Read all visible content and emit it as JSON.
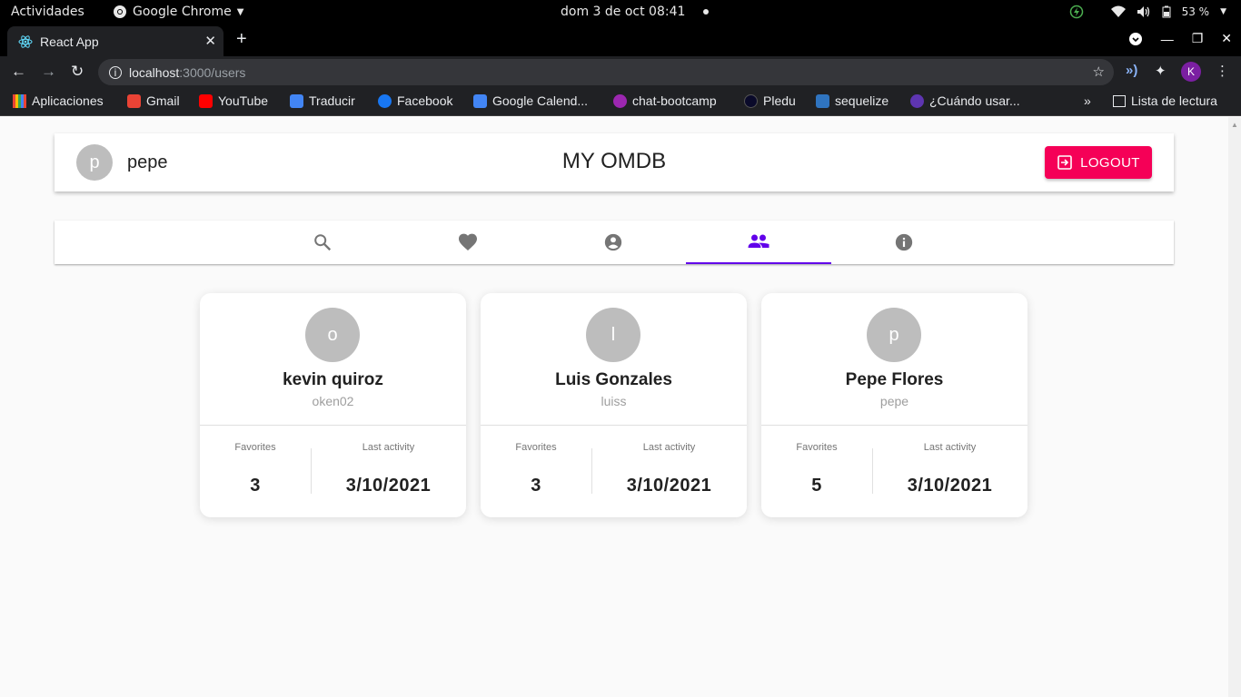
{
  "os": {
    "activities": "Actividades",
    "app_name": "Google Chrome",
    "date": "dom  3 de oct  08:41",
    "battery": "53 %"
  },
  "browser": {
    "tab_title": "React App",
    "url_host": "localhost",
    "url_path": ":3000/users",
    "profile_initial": "K",
    "bookmarks": [
      {
        "label": "Aplicaciones",
        "color": "#4285f4"
      },
      {
        "label": "Gmail",
        "color": "#ea4335"
      },
      {
        "label": "YouTube",
        "color": "#ff0000"
      },
      {
        "label": "Traducir",
        "color": "#4285f4"
      },
      {
        "label": "Facebook",
        "color": "#1877f2"
      },
      {
        "label": "Google Calend...",
        "color": "#4285f4"
      },
      {
        "label": "chat-bootcamp",
        "color": "#9c27b0"
      },
      {
        "label": "Pledu",
        "color": "#0a0a2a"
      },
      {
        "label": "sequelize",
        "color": "#2f74c0"
      },
      {
        "label": "¿Cuándo usar...",
        "color": "#5e35b1"
      }
    ],
    "reading_list": "Lista de lectura"
  },
  "header": {
    "avatar_initial": "p",
    "username": "pepe",
    "title": "MY OMDB",
    "logout_label": "LOGOUT",
    "accent": "#f50057"
  },
  "nav_tabs": [
    {
      "icon": "search-icon",
      "active": false
    },
    {
      "icon": "heart-icon",
      "active": false
    },
    {
      "icon": "account-circle-icon",
      "active": false
    },
    {
      "icon": "people-icon",
      "active": true
    },
    {
      "icon": "info-icon",
      "active": false
    }
  ],
  "active_color": "#6200ea",
  "users": [
    {
      "initial": "o",
      "name": "kevin quiroz",
      "handle": "oken02",
      "favorites_label": "Favorites",
      "favorites": "3",
      "activity_label": "Last activity",
      "last_activity": "3/10/2021"
    },
    {
      "initial": "l",
      "name": "Luis Gonzales",
      "handle": "luiss",
      "favorites_label": "Favorites",
      "favorites": "3",
      "activity_label": "Last activity",
      "last_activity": "3/10/2021"
    },
    {
      "initial": "p",
      "name": "Pepe Flores",
      "handle": "pepe",
      "favorites_label": "Favorites",
      "favorites": "5",
      "activity_label": "Last activity",
      "last_activity": "3/10/2021"
    }
  ]
}
